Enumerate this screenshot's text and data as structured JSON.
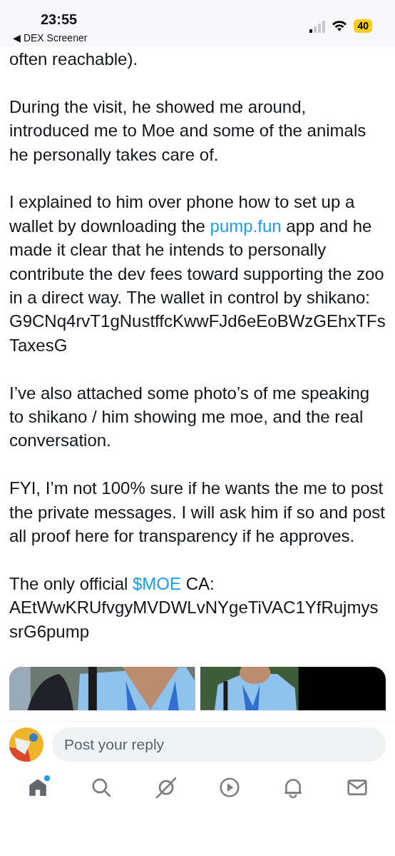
{
  "status_bar": {
    "time": "23:55",
    "back_app": "◀ DEX Screener",
    "battery": "40",
    "low_power": true
  },
  "paragraphs": [
    [
      {
        "text": "often reachable)."
      }
    ],
    [
      {
        "text": "During the visit, he showed me around, introduced me to Moe and some of the animals he personally takes care of."
      }
    ],
    [
      {
        "text": "I explained to him over phone how to set up a wallet by downloading the "
      },
      {
        "text": "pump.fun",
        "kind": "link"
      },
      {
        "text": " app and he made it clear that he intends to personally contribute the dev fees toward supporting the zoo in a direct way. The wallet in control by shikano: G9CNq4rvT1gNustffcKwwFJd6eEoBWzGEhxTFsTaxesG"
      }
    ],
    [
      {
        "text": "I’ve also attached some photo’s of me speaking to shikano / him showing me moe, and the real conversation."
      }
    ],
    [
      {
        "text": "FYI, I’m not 100% sure if he wants the me to post the private messages. I will ask him if so and post all proof here for transparency if he approves."
      }
    ],
    [
      {
        "text": "The only official "
      },
      {
        "text": "$MOE",
        "kind": "link"
      },
      {
        "text": " CA: AEtWwKRUfvgyMVDWLvNYgeTiVAC1YfRujmyssrG6pump"
      }
    ]
  ],
  "media": [
    {
      "kind": "picture"
    },
    {
      "kind": "picture"
    }
  ],
  "reply": {
    "placeholder": "Post your reply"
  },
  "tab_bar": [
    {
      "selected": true,
      "badge": true
    },
    {
      "selected": false,
      "badge": false
    },
    {
      "selected": false,
      "badge": false
    },
    {
      "selected": false,
      "badge": false
    },
    {
      "selected": false,
      "badge": false
    },
    {
      "selected": false,
      "badge": false
    }
  ]
}
